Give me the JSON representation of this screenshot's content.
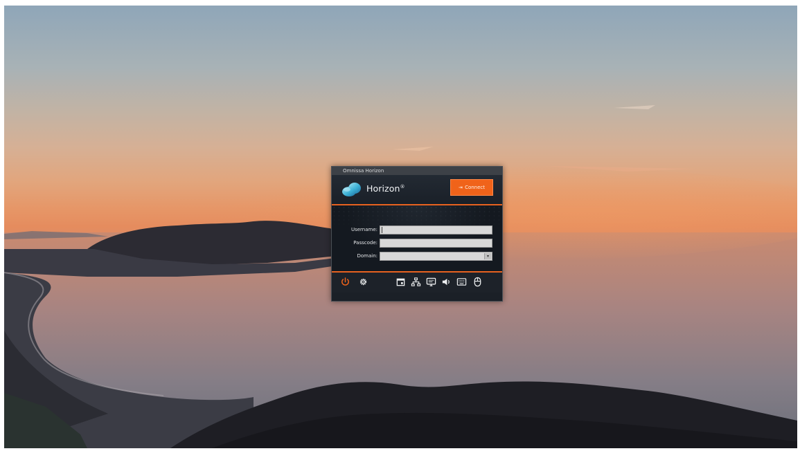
{
  "window": {
    "title": "Omnissa Horizon"
  },
  "header": {
    "brand": "Horizon",
    "brand_mark": "®",
    "connect_label": "Connect",
    "connect_icon": "login-arrow-icon",
    "logo_icon": "cloud-icon"
  },
  "form": {
    "username": {
      "label": "Username:",
      "value": ""
    },
    "passcode": {
      "label": "Passcode:",
      "value": ""
    },
    "domain": {
      "label": "Domain:",
      "value": ""
    }
  },
  "toolbar": {
    "left": [
      "power-icon",
      "settings-gear-icon"
    ],
    "right": [
      "calendar-icon",
      "network-icon",
      "display-icon",
      "volume-icon",
      "keyboard-icon",
      "mouse-icon"
    ]
  },
  "colors": {
    "accent": "#f0631a",
    "dialog_bg": "#1b2027",
    "titlebar_bg": "#3d4147"
  }
}
